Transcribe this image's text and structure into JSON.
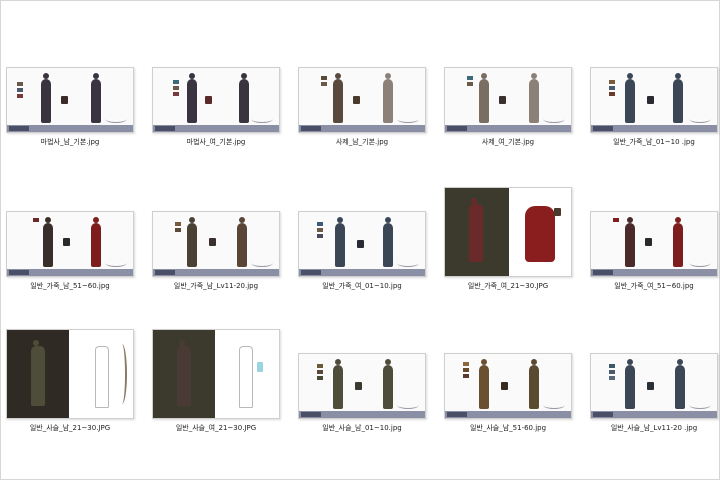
{
  "files": [
    {
      "name": "마법사_남_기본.jpg"
    },
    {
      "name": "마법사_여_기본.jpg"
    },
    {
      "name": "사제_남_기본.jpg"
    },
    {
      "name": "사제_여_기본.jpg"
    },
    {
      "name": "일반_가죽_남_01~10 .jpg"
    },
    {
      "name": "일반_가죽_남_51~60.jpg"
    },
    {
      "name": "일반_가죽_남_Lv11-20.jpg"
    },
    {
      "name": "일반_가죽_여_01~10.jpg"
    },
    {
      "name": "일반_가죽_여_21~30.JPG"
    },
    {
      "name": "일반_가죽_여_51~60.jpg"
    },
    {
      "name": "일반_사슬_남_21~30.JPG"
    },
    {
      "name": "일반_사슬_여_21~30.JPG"
    },
    {
      "name": "일반_사슬_남_01~10.jpg"
    },
    {
      "name": "일반_사슬_남_51-60.jpg"
    },
    {
      "name": "일반_사슬_남_Lv11-20 .jpg"
    }
  ],
  "colors": {
    "robe_dark": "#3a3340",
    "robe_grey": "#8b8178",
    "leather": "#4b4236",
    "leather_blue": "#3b4656",
    "chain_olive": "#4d4d3a",
    "red": "#7d1d1d",
    "bar": "#8b8fa6"
  }
}
